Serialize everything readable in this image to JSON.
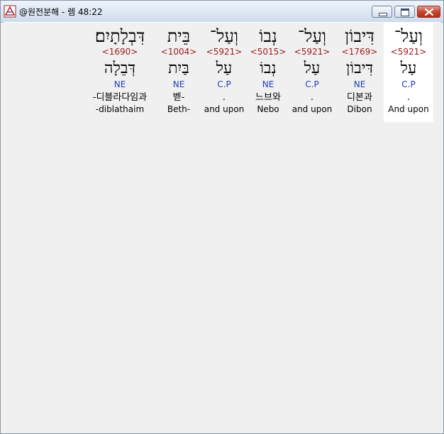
{
  "window": {
    "title": "@원전분해 - 렘 48:22"
  },
  "columns": [
    {
      "hebrew": "וְעַל־",
      "strongs": "<5921>",
      "lemma": "עַל",
      "pos": "C.P",
      "korean": ".",
      "english": "And upon"
    },
    {
      "hebrew": "דִּיבוֹן",
      "strongs": "<1769>",
      "lemma": "דִּיבוֹן",
      "pos": "NE",
      "korean": "디본과",
      "english": "Dibon"
    },
    {
      "hebrew": "וְעַל־",
      "strongs": "<5921>",
      "lemma": "עַל",
      "pos": "C.P",
      "korean": ".",
      "english": "and upon"
    },
    {
      "hebrew": "נְבוֹ",
      "strongs": "<5015>",
      "lemma": "נְבוֹ",
      "pos": "NE",
      "korean": "느브와",
      "english": "Nebo"
    },
    {
      "hebrew": "וְעַל־",
      "strongs": "<5921>",
      "lemma": "עַל",
      "pos": "C.P",
      "korean": ".",
      "english": "and upon"
    },
    {
      "hebrew": "בֵּית",
      "strongs": "<1004>",
      "lemma": "בַּיִת",
      "pos": "NE",
      "korean": "벧-",
      "english": "Beth-"
    },
    {
      "hebrew": "דִּבְלָתָיִם׃",
      "strongs": "<1690>",
      "lemma": "דְּבֵלָה",
      "pos": "NE",
      "korean": "-디블라다임과",
      "english": "-diblathaim"
    }
  ]
}
